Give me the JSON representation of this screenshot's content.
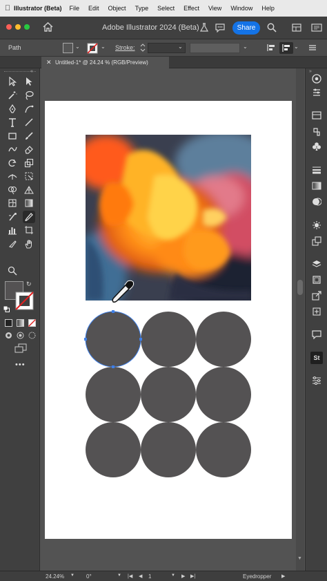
{
  "menubar": {
    "app_name": "Illustrator (Beta)",
    "items": [
      "File",
      "Edit",
      "Object",
      "Type",
      "Select",
      "Effect",
      "View",
      "Window",
      "Help"
    ]
  },
  "titlebar": {
    "title": "Adobe Illustrator 2024 (Beta)",
    "share_label": "Share"
  },
  "control_bar": {
    "selection_label": "Path",
    "stroke_label": "Stroke:"
  },
  "document_tab": {
    "title": "Untitled-1* @ 24.24 % (RGB/Preview)"
  },
  "status_bar": {
    "zoom": "24.24%",
    "rotation": "0°",
    "artboard_number": "1",
    "current_tool": "Eyedropper"
  },
  "colors": {
    "accent": "#1473e6",
    "circle_fill": "#545253",
    "canvas_bg": "#535353"
  }
}
